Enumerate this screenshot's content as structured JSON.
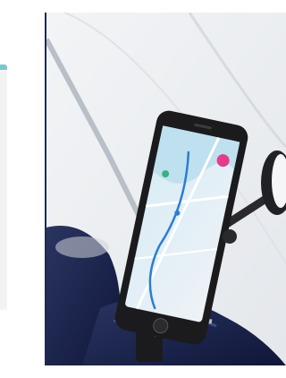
{
  "image": {
    "subject": "smartphone-in-mount-on-scooter-handlebar",
    "colors": {
      "background_sky": "#eceef1",
      "accent_stripe": "#79c7cf",
      "divider": "#1c2b4f",
      "scooter_body": "#1a2347",
      "phone_frame": "#1b1b1d",
      "map_water": "#bfe0ee",
      "map_land": "#eef1f4",
      "map_roads": "#ffffff",
      "route_line": "#2d7dd2",
      "pin_pink": "#e23c8a",
      "pin_green": "#35b37e"
    }
  }
}
